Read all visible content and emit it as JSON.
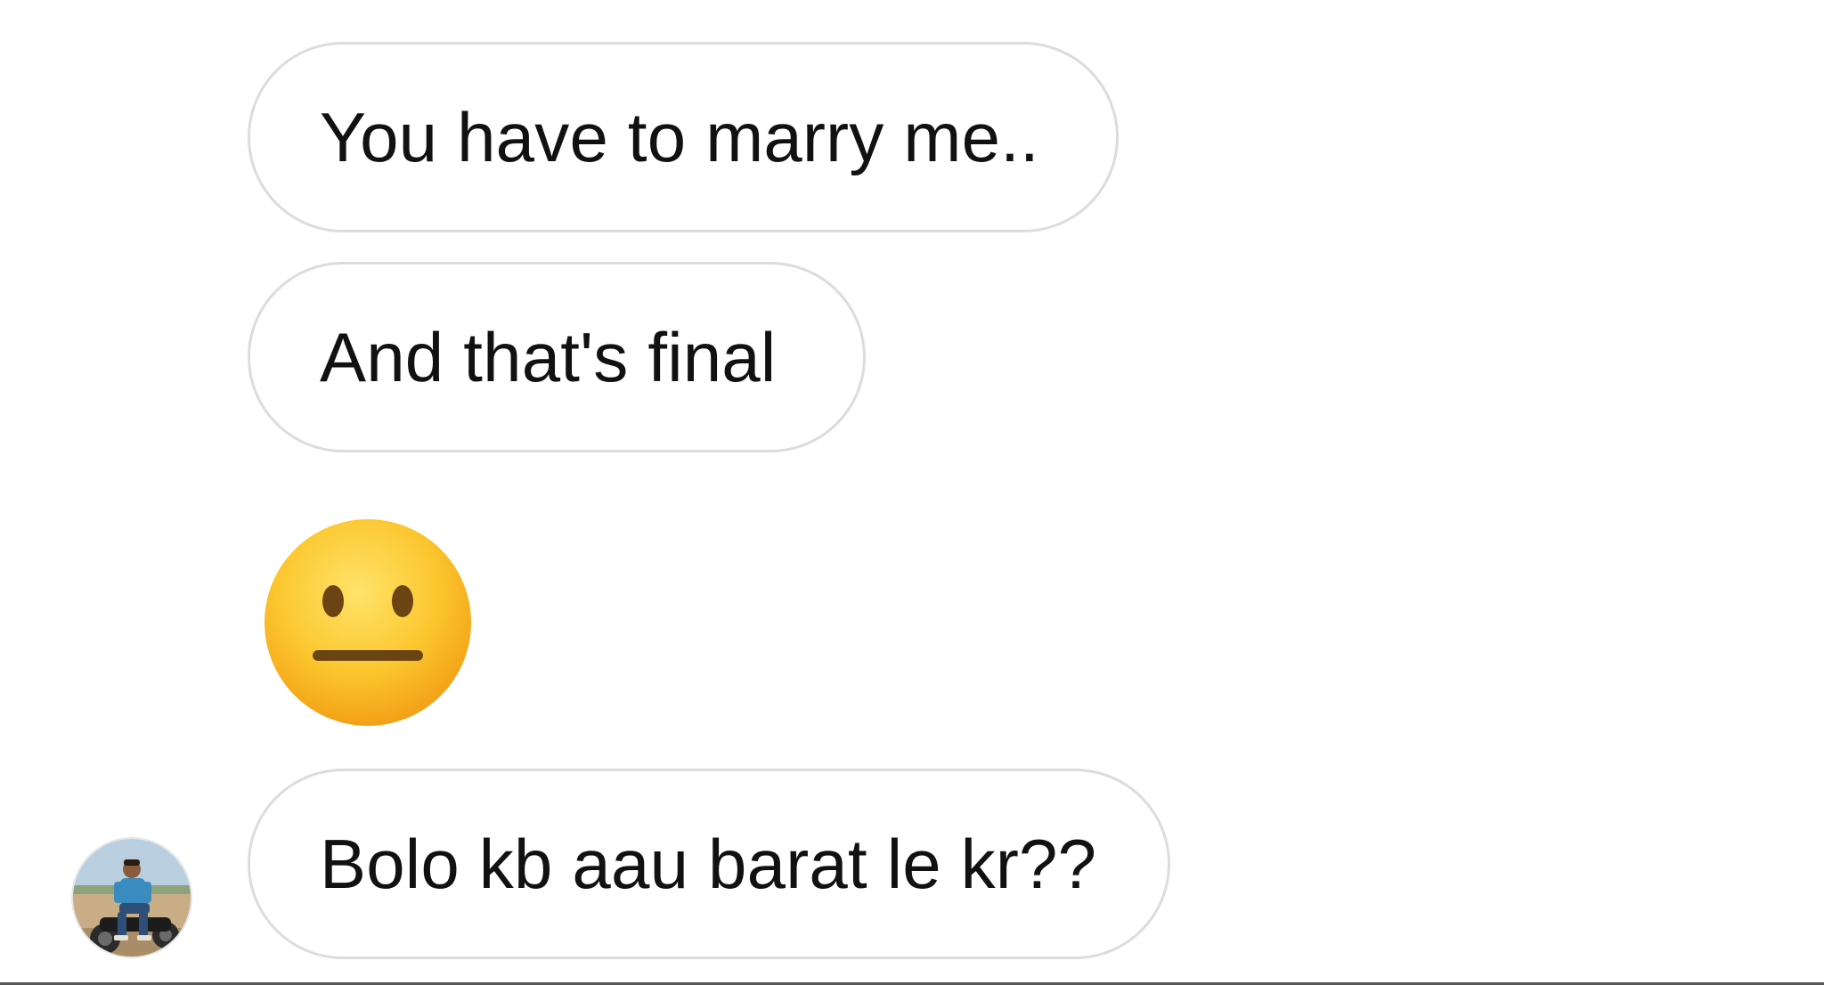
{
  "messages": [
    {
      "text": "You have to marry me.."
    },
    {
      "text": "And that's final"
    },
    {
      "emoji": "neutral-face"
    },
    {
      "text": "Bolo kb aau barat le kr??"
    }
  ],
  "sender": {
    "avatar": "profile-photo"
  },
  "colors": {
    "bubble_border": "#dcdcdc",
    "text": "#111111",
    "emoji_face": "#f9c02c",
    "background": "#ffffff"
  }
}
